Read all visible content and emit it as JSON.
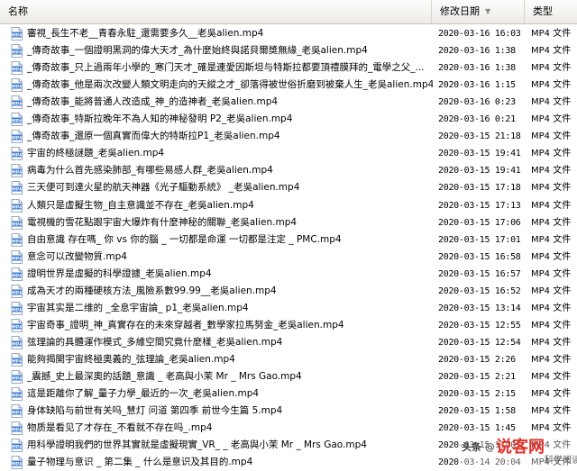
{
  "header": {
    "name_label": "名称",
    "date_label": "修改日期",
    "type_label": "类型",
    "sort_indicator": "▼"
  },
  "files": [
    {
      "name": "審視_長生不老__青春永駐_還需要多久__老吳alien.mp4",
      "date": "2020-03-16 16:03",
      "type": "MP4 文件"
    },
    {
      "name": "_傳奇故事_一個證明黑洞的偉大天才_為什麼始終與諾貝爾獎無緣_老吳alien.mp4",
      "date": "2020-03-16 1:38",
      "type": "MP4 文件"
    },
    {
      "name": "_傳奇故事_只上過兩年小學的_寒门天才_確是連愛因斯坦与特斯拉都要頂禮膜拜的_電學之父_...",
      "date": "2020-03-16 1:38",
      "type": "MP4 文件"
    },
    {
      "name": "_傳奇故事_他是兩次改變人類文明走向的天縱之才_卻落得被世俗折磨到被棄人生_老吳alien.mp4",
      "date": "2020-03-16 1:15",
      "type": "MP4 文件"
    },
    {
      "name": "_傳奇故事_能將普通人改造成_神_的造神者_老吳alien.mp4",
      "date": "2020-03-16 0:23",
      "type": "MP4 文件"
    },
    {
      "name": "_傳奇故事_特斯拉晚年不為人知的神秘發明 P2_老吳alien.mp4",
      "date": "2020-03-16 0:21",
      "type": "MP4 文件"
    },
    {
      "name": "_傳奇故事_還原一個真實而偉大的特斯拉P1_老吳alien.mp4",
      "date": "2020-03-15 21:18",
      "type": "MP4 文件"
    },
    {
      "name": "宇宙的終極謎題_老吳alien.mp4",
      "date": "2020-03-15 19:41",
      "type": "MP4 文件"
    },
    {
      "name": "病毒为什么首先感染肺部_有哪些易感人群_老吳alien.mp4",
      "date": "2020-03-15 19:41",
      "type": "MP4 文件"
    },
    {
      "name": "三天便可到達火星的航天神器《光子驅動系統》 _老吳alien.mp4",
      "date": "2020-03-15 17:18",
      "type": "MP4 文件"
    },
    {
      "name": "人類只是虛擬生物_自主意識並不存在_老吳alien.mp4",
      "date": "2020-03-15 17:13",
      "type": "MP4 文件"
    },
    {
      "name": "電視機的雪花點跟宇宙大爆炸有什麼神秘的關聯_老吳alien.mp4",
      "date": "2020-03-15 17:06",
      "type": "MP4 文件"
    },
    {
      "name": "自由意識 存在嗎_ 你 vs 你的腦 _ 一切都是命運 一切都是注定 _ PMC.mp4",
      "date": "2020-03-15 17:01",
      "type": "MP4 文件"
    },
    {
      "name": "意念可以改變物質.mp4",
      "date": "2020-03-15 16:58",
      "type": "MP4 文件"
    },
    {
      "name": "證明世界是虛擬的科學證據_老吳alien.mp4",
      "date": "2020-03-15 16:57",
      "type": "MP4 文件"
    },
    {
      "name": "成為天才的兩種硬核方法_風險系數99.99__老吳alien.mp4",
      "date": "2020-03-15 16:52",
      "type": "MP4 文件"
    },
    {
      "name": "宇宙其实是二维的 _全息宇宙論_ p1_老吳alien.mp4",
      "date": "2020-03-15 13:14",
      "type": "MP4 文件"
    },
    {
      "name": "宇宙奇事_證明_神_真實存在的未來穿越者_數學家拉馬努金_老吳alien.mp4",
      "date": "2020-03-15 12:55",
      "type": "MP4 文件"
    },
    {
      "name": "弦理論的具體運作模式_多維空間究竟什麼樣_老吳alien.mp4",
      "date": "2020-03-15 12:54",
      "type": "MP4 文件"
    },
    {
      "name": "能夠揭開宇宙終極奧義的_弦理論_老吳alien.mp4",
      "date": "2020-03-15 2:26",
      "type": "MP4 文件"
    },
    {
      "name": "_震撼_史上最深奧的話題_意識 _ 老高與小茉 Mr _ Mrs Gao.mp4",
      "date": "2020-03-15 2:21",
      "type": "MP4 文件"
    },
    {
      "name": "這是距離你了解_量子力學_最近的一次_老吳alien.mp4",
      "date": "2020-03-15 2:15",
      "type": "MP4 文件"
    },
    {
      "name": "身体缺陷与前世有关吗_慧灯 问道 第四季 前世今生篇 5.mp4",
      "date": "2020-03-15 1:58",
      "type": "MP4 文件"
    },
    {
      "name": "物质是看见了才存在_不看就不存在吗_.mp4",
      "date": "2020-03-15 1:45",
      "type": "MP4 文件"
    },
    {
      "name": "用科學證明我們的世界其實就是虛擬現實_VR_ _ 老高與小茉 Mr _ Mrs Gao.mp4",
      "date": "2020-03-15 1:40",
      "type": "MP4 文件"
    },
    {
      "name": "量子物理与意识 _ 第二集 _ 什么是意识及其目的.mp4",
      "date": "2020-03-14 20:04",
      "type": "MP4 文件"
    }
  ],
  "icon": {
    "name": "mp4-file-icon",
    "text": "MP4",
    "color": "#3a7bd5"
  },
  "watermark": {
    "text": "头条 @说客网 科学阅读",
    "color": "#e2322b"
  }
}
